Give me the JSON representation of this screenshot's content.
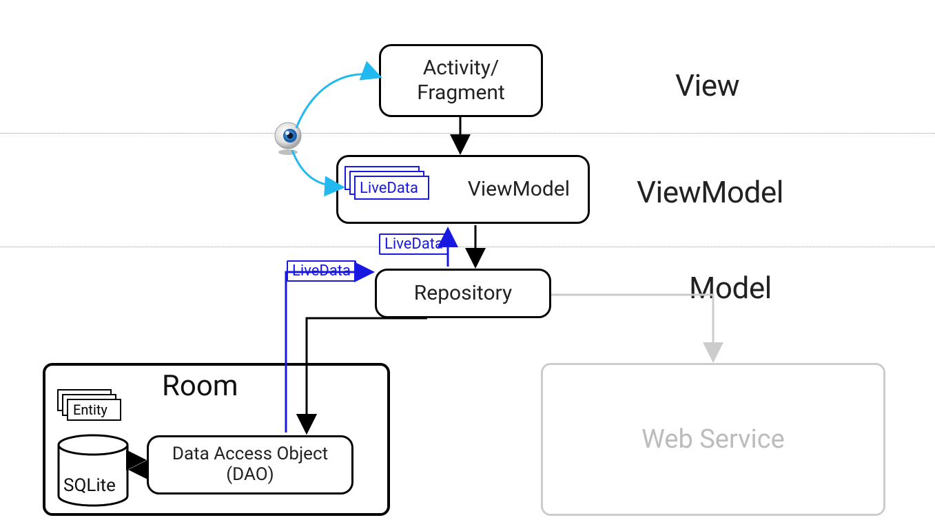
{
  "layers": {
    "view": "View",
    "viewmodel": "ViewModel",
    "model": "Model"
  },
  "boxes": {
    "activity_fragment": "Activity/\nFragment",
    "viewmodel": "ViewModel",
    "repository": "Repository",
    "dao": "Data Access Object\n(DAO)",
    "webservice": "Web Service"
  },
  "tags": {
    "livedata_vm": "LiveData",
    "livedata_mid": "LiveData",
    "livedata_repo": "LiveData",
    "entity": "Entity"
  },
  "room": {
    "title": "Room",
    "sqlite": "SQLite"
  }
}
